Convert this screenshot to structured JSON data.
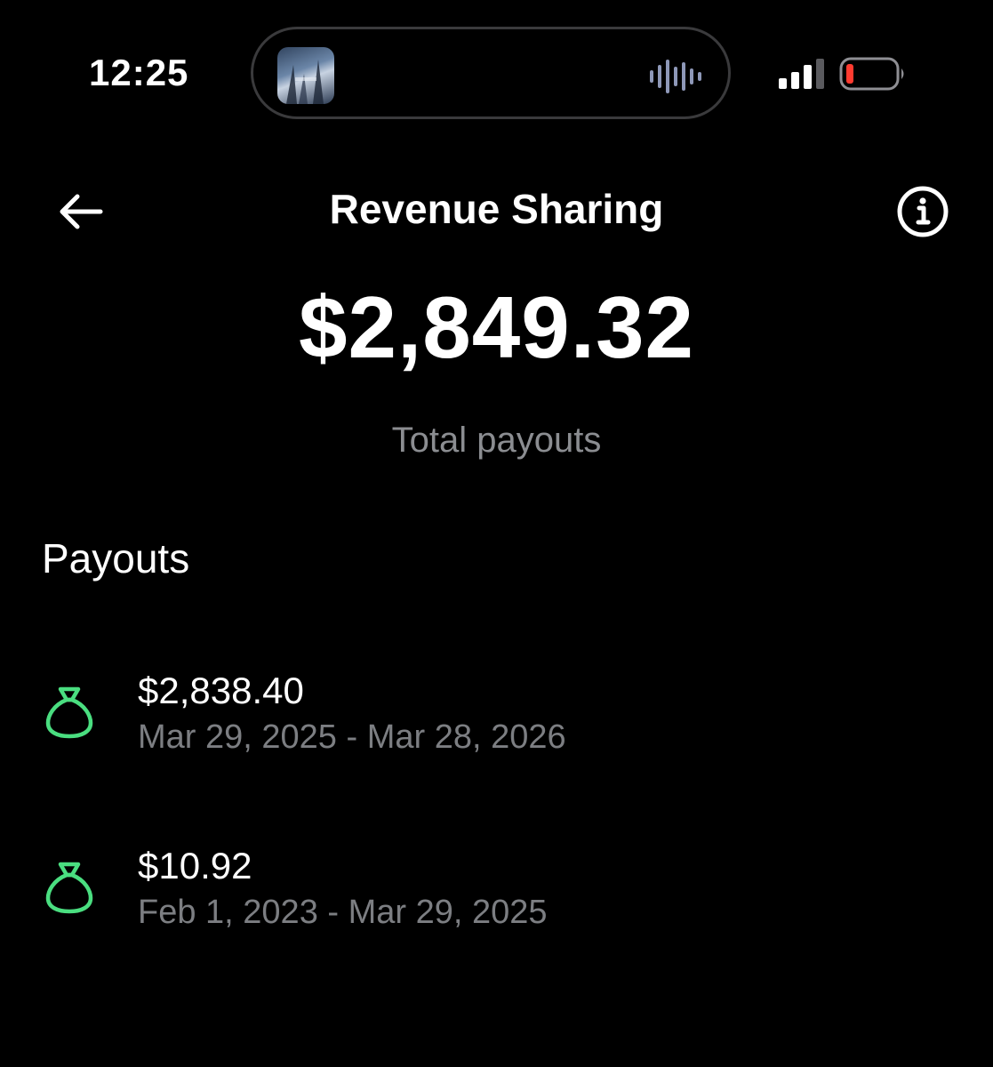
{
  "status_bar": {
    "time": "12:25"
  },
  "header": {
    "title": "Revenue Sharing",
    "back_icon": "arrow-left-icon",
    "info_icon": "info-circle-icon"
  },
  "summary": {
    "total_amount": "$2,849.32",
    "total_label": "Total payouts"
  },
  "payouts": {
    "heading": "Payouts",
    "icon": "money-bag-icon",
    "items": [
      {
        "amount": "$2,838.40",
        "period": "Mar 29, 2025 - Mar 28, 2026"
      },
      {
        "amount": "$10.92",
        "period": "Feb 1, 2023 - Mar 29, 2025"
      }
    ]
  },
  "colors": {
    "background": "#000000",
    "text_primary": "#ffffff",
    "text_secondary": "#7c7e82",
    "accent_green": "#4ade80",
    "battery_low": "#ff3b30"
  }
}
